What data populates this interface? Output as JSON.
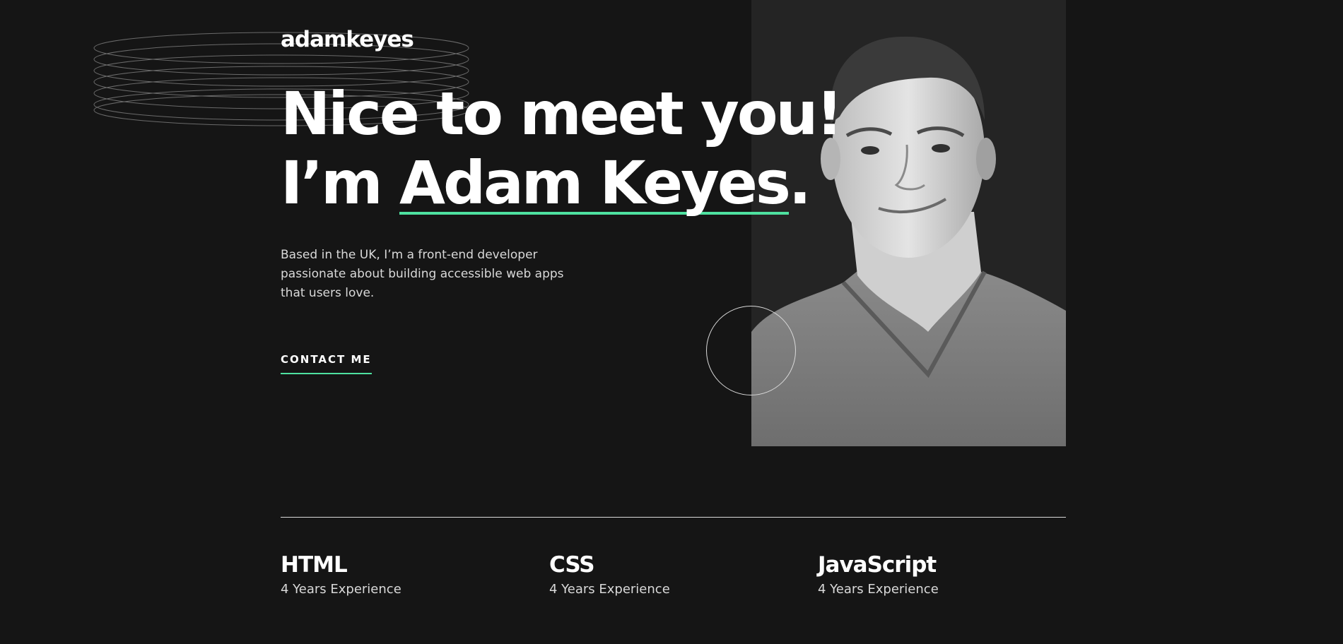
{
  "brand": {
    "logo_text": "adamkeyes"
  },
  "hero": {
    "headline_line1": "Nice to meet you!",
    "headline_prefix": "I’m ",
    "headline_name": "Adam Keyes",
    "headline_suffix": ".",
    "intro": "Based in the UK, I’m a front-end developer passionate about building accessible web apps that users love.",
    "contact_label": "CONTACT ME"
  },
  "skills": [
    {
      "name": "HTML",
      "experience": "4 Years Experience"
    },
    {
      "name": "CSS",
      "experience": "4 Years Experience"
    },
    {
      "name": "JavaScript",
      "experience": "4 Years Experience"
    }
  ],
  "colors": {
    "background": "#151515",
    "panel": "#242424",
    "accent": "#4ee1a0",
    "text": "#ffffff",
    "muted_text": "#d9d9d9"
  },
  "icons": {
    "rings": "rings-pattern-icon",
    "circle": "circle-pattern-icon"
  }
}
